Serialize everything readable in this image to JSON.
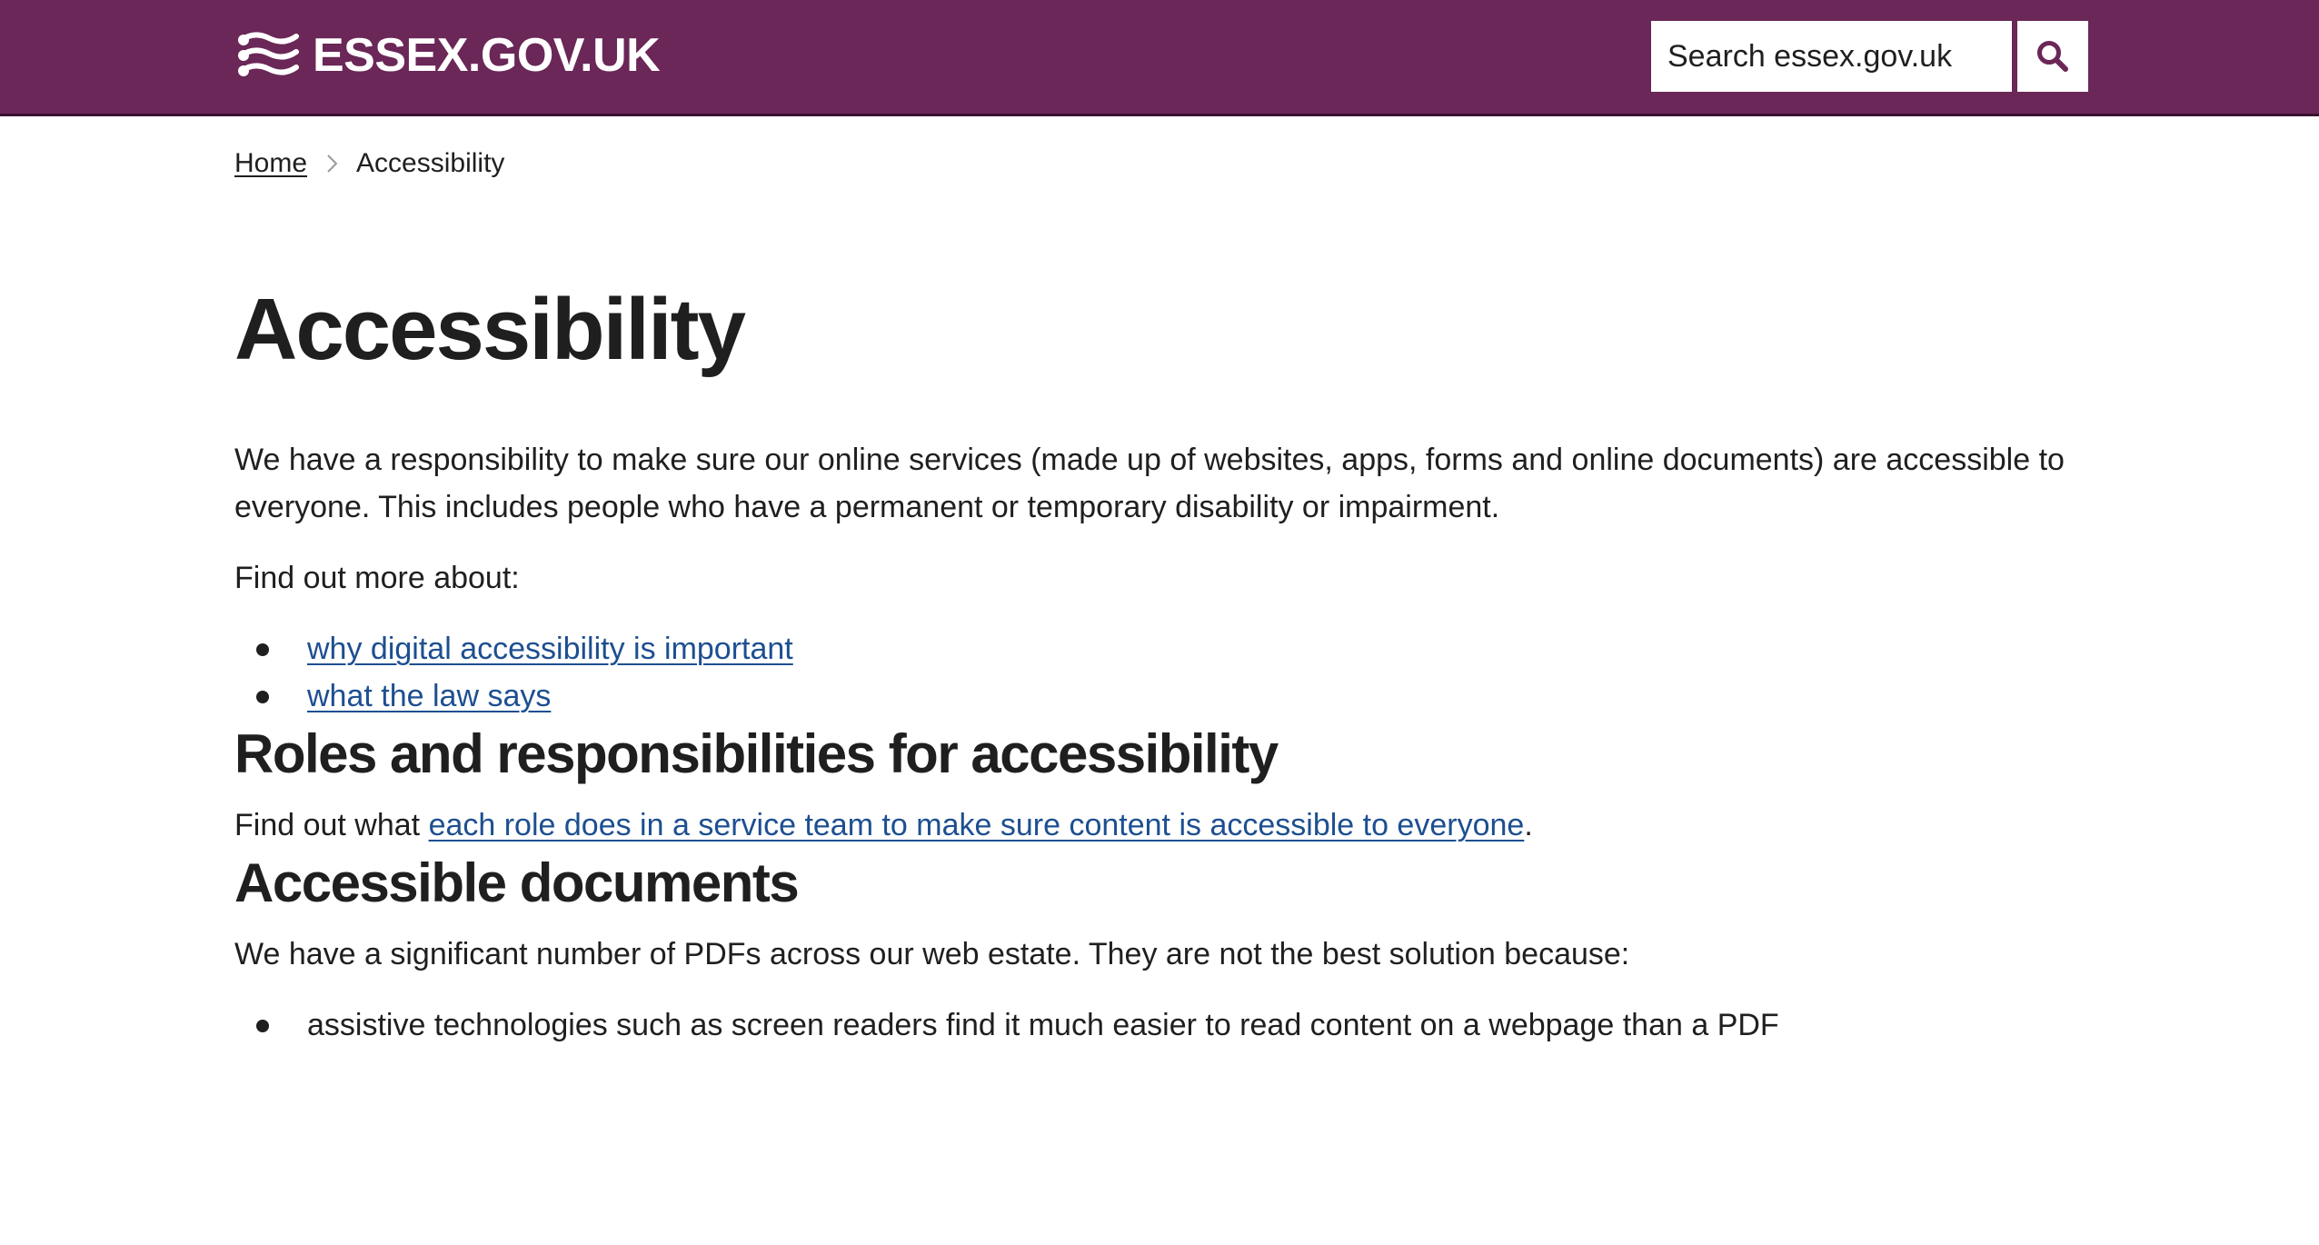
{
  "header": {
    "logo_text": "ESSEX.GOV.UK",
    "logo_icon": "essex-seaxes-icon",
    "search_placeholder": "Search essex.gov.uk",
    "search_icon": "search-icon",
    "brand_color": "#6a2757"
  },
  "breadcrumb": {
    "home": "Home",
    "separator_icon": "chevron-right-icon",
    "current": "Accessibility"
  },
  "page": {
    "title": "Accessibility",
    "intro": "We have a responsibility to make sure our online services (made up of websites, apps, forms and online documents) are accessible to everyone. This includes people who have a permanent or temporary disability or impairment.",
    "find_out_more": "Find out more about:",
    "links": [
      "why digital accessibility is important",
      "what the law says"
    ]
  },
  "roles": {
    "heading": "Roles and responsibilities for accessibility",
    "text_before": "Find out what ",
    "link": "each role does in a service team to make sure content is accessible to everyone",
    "text_after": "."
  },
  "documents": {
    "heading": "Accessible documents",
    "intro": "We have a significant number of PDFs across our web estate. They are not the best solution because:",
    "items": [
      "assistive technologies such as screen readers find it much easier to read content on a webpage than a PDF"
    ]
  },
  "colors": {
    "link": "#1d4f91",
    "text": "#1f1f1f"
  }
}
